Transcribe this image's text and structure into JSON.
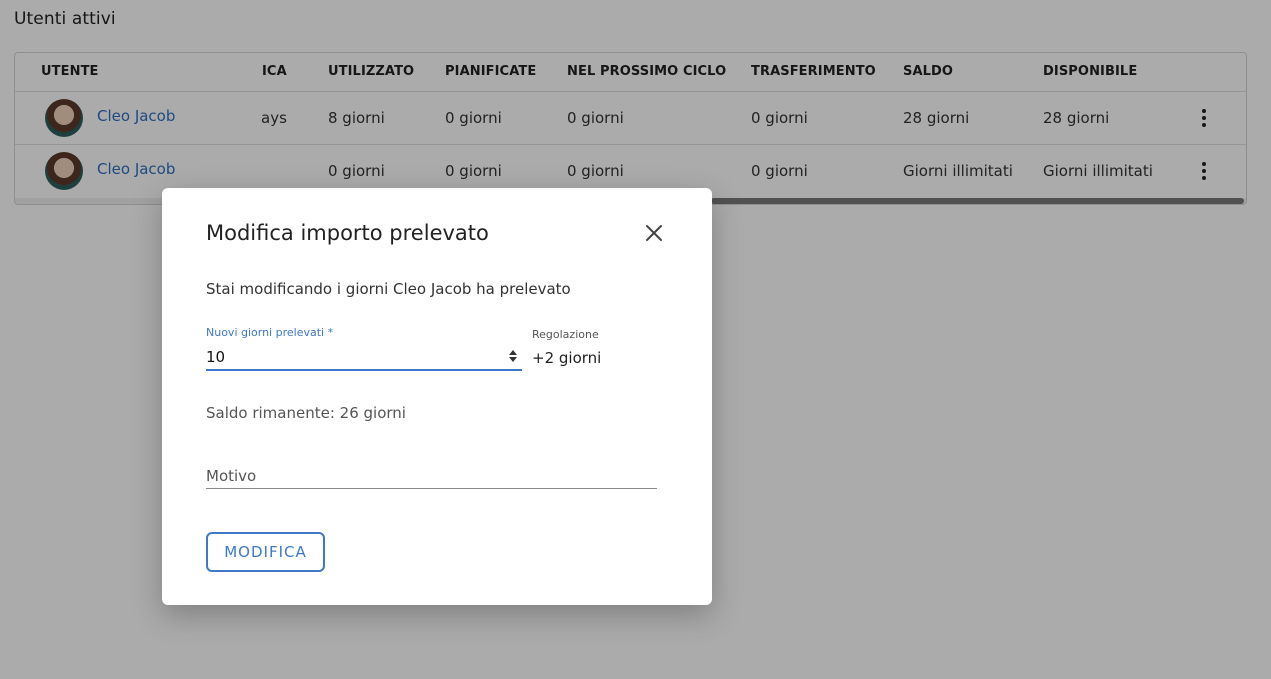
{
  "page": {
    "section_title": "Utenti attivi"
  },
  "table": {
    "headers": {
      "utente": "UTENTE",
      "politica": "ICA",
      "utilizzato": "UTILIZZATO",
      "pianificate": "PIANIFICATE",
      "prossimo_ciclo": "NEL PROSSIMO CICLO",
      "trasferimento": "TRASFERIMENTO",
      "saldo": "SALDO",
      "disponibile": "DISPONIBILE"
    },
    "rows": [
      {
        "user": "Cleo Jacob",
        "politica": "ays",
        "utilizzato": "8 giorni",
        "pianificate": "0 giorni",
        "prossimo_ciclo": "0 giorni",
        "trasferimento": "0 giorni",
        "saldo": "28 giorni",
        "disponibile": "28 giorni"
      },
      {
        "user": "Cleo Jacob",
        "politica": "",
        "utilizzato": "0 giorni",
        "pianificate": "0 giorni",
        "prossimo_ciclo": "0 giorni",
        "trasferimento": "0 giorni",
        "saldo": "Giorni illimitati",
        "disponibile": "Giorni illimitati"
      }
    ]
  },
  "dialog": {
    "title": "Modifica importo prelevato",
    "description": "Stai modificando i giorni Cleo Jacob ha prelevato",
    "new_days_label": "Nuovi giorni prelevati *",
    "new_days_value": "10",
    "adjustment_label": "Regolazione",
    "adjustment_value": "+2 giorni",
    "remaining_balance": "Saldo rimanente: 26 giorni",
    "reason_placeholder": "Motivo",
    "submit_label": "MODIFICA"
  },
  "colors": {
    "accent": "#3e78c8",
    "link": "#2f6fbf",
    "overlay": "rgba(0,0,0,0.33)"
  },
  "icons": {
    "close": "close-icon",
    "row_menu": "more-vertical-icon",
    "number_spinner": "spinner-icon"
  }
}
